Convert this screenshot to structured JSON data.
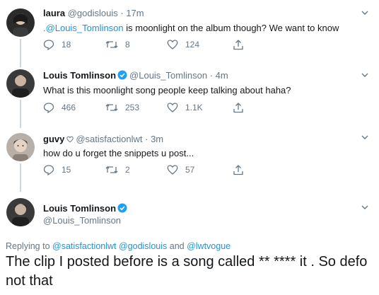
{
  "tweets": [
    {
      "name": "laura",
      "handle": "@godislouis",
      "dot": "·",
      "time": "17m",
      "mention": ".@Louis_Tomlinson",
      "text": " is moonlight on the album though? We want to know",
      "replies": "18",
      "retweets": "8",
      "likes": "124"
    },
    {
      "name": "Louis Tomlinson",
      "handle": "@Louis_Tomlinson",
      "dot": "·",
      "time": "4m",
      "text": "What is this moonlight song people keep talking about haha?",
      "replies": "466",
      "retweets": "253",
      "likes": "1.1K"
    },
    {
      "name": "guvy",
      "handle": "@satisfactionlwt",
      "dot": "·",
      "time": "3m",
      "text": "how do u forget the snippets u post...",
      "replies": "15",
      "retweets": "2",
      "likes": "57"
    }
  ],
  "main": {
    "name": "Louis Tomlinson",
    "handle": "@Louis_Tomlinson",
    "replying_prefix": "Replying to ",
    "reply_mentions": "@satisfactionlwt @godislouis",
    "and": " and ",
    "reply_last": "@lwtvogue",
    "text": "The clip I posted before is a song called ** **** it . So defo not that"
  },
  "colors": {
    "accent": "#1b95e0",
    "verified": "#1da1f2",
    "muted": "#657786",
    "text": "#14171a"
  },
  "icons": [
    "reply-icon",
    "retweet-icon",
    "like-icon",
    "share-icon",
    "chevron-down-icon",
    "verified-badge-icon",
    "heart-badge-icon"
  ]
}
